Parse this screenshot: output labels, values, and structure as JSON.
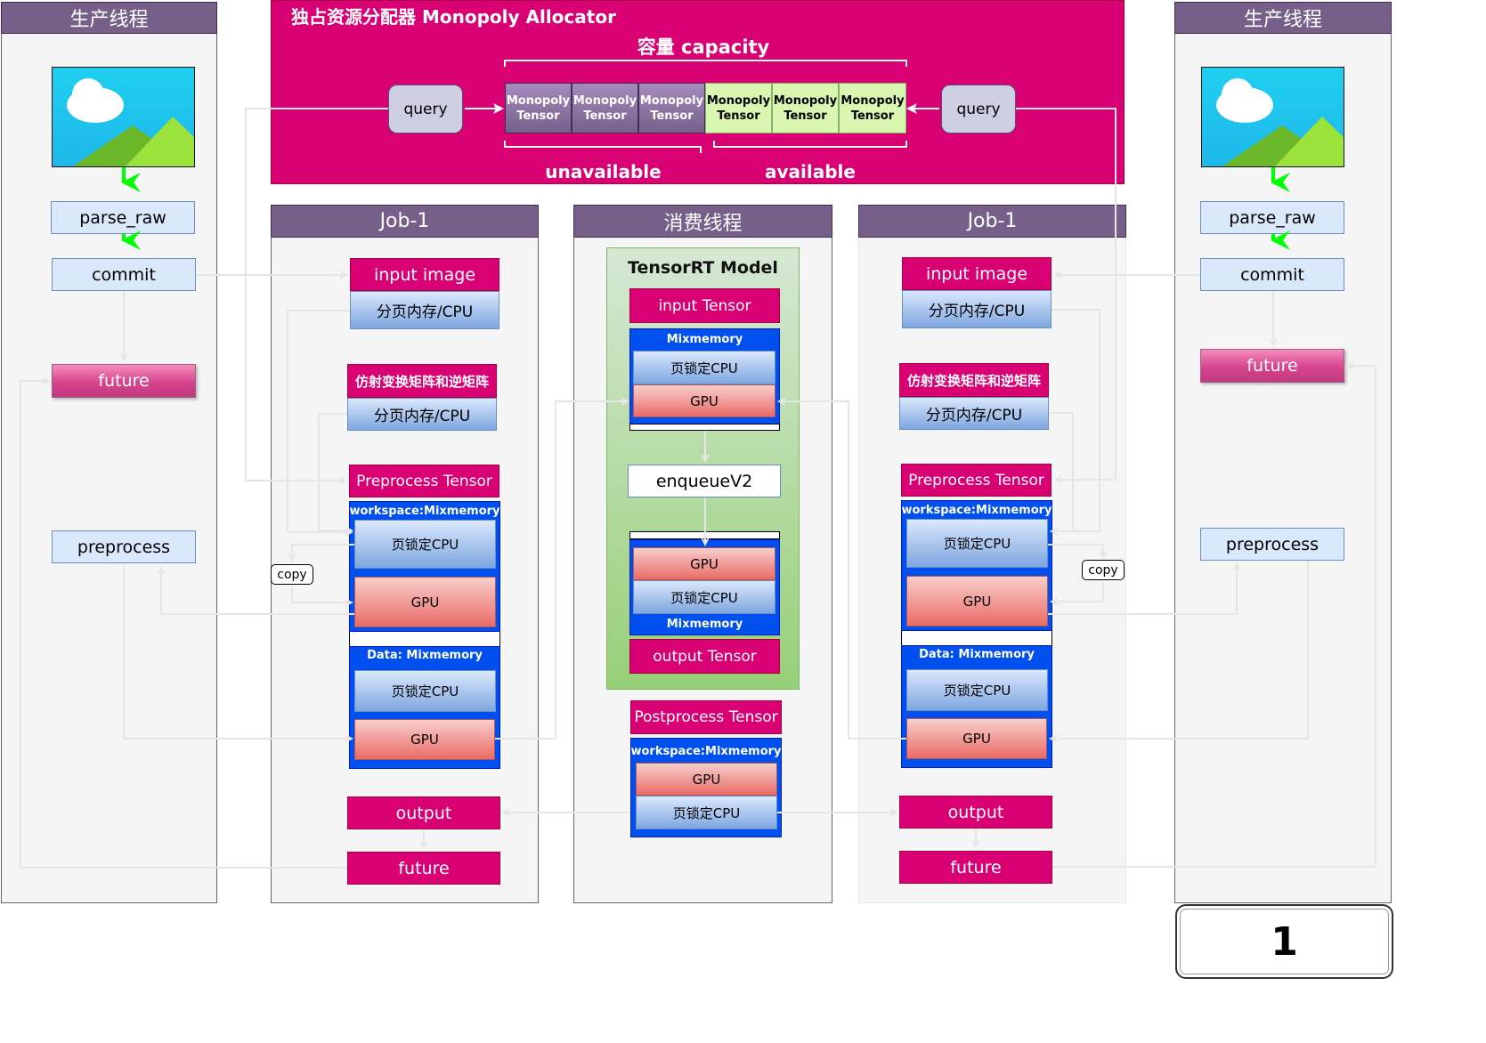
{
  "producer_title": "生产线程",
  "consumer_title": "消费线程",
  "job_title": "Job-1",
  "allocator": {
    "title": "独占资源分配器 Monopoly Allocator",
    "capacity": "容量 capacity",
    "query": "query",
    "tensor_line1": "Monopoly",
    "tensor_line2": "Tensor",
    "unavailable": "unavailable",
    "available": "available"
  },
  "labels": {
    "parse_raw": "parse_raw",
    "commit": "commit",
    "future": "future",
    "preprocess": "preprocess",
    "input_image": "input image",
    "paged_cpu": "分页内存/CPU",
    "affine": "仿射变换矩阵和逆矩阵",
    "preprocess_tensor": "Preprocess Tensor",
    "workspace": "workspace:Mixmemory",
    "pinned_cpu": "页锁定CPU",
    "gpu": "GPU",
    "data": "Data: Mixmemory",
    "output": "output",
    "copy": "copy"
  },
  "consumer": {
    "model": "TensorRT Model",
    "input_tensor": "input Tensor",
    "mixmemory": "Mixmemory",
    "enqueue": "enqueueV2",
    "output_tensor": "output Tensor",
    "postprocess": "Postprocess Tensor"
  },
  "page_number": "1",
  "colors": {
    "lane_header": "#76608a",
    "allocator": "#d80073",
    "magenta": "#d80073",
    "mixmemory": "#0050ef",
    "green_panel": "#b9e0a5",
    "arrow_green": "#00ff00"
  }
}
